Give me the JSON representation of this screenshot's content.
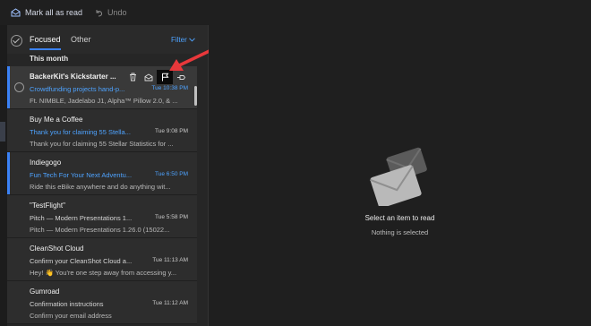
{
  "toolbar": {
    "mark_all_read": "Mark all as read",
    "undo": "Undo"
  },
  "tabs": {
    "focused": "Focused",
    "other": "Other",
    "filter": "Filter"
  },
  "section_header": "This month",
  "messages": [
    {
      "sender": "BackerKit's Kickstarter ...",
      "subject": "Crowdfunding projects hand-p...",
      "time": "Tue 10:38 PM",
      "preview": "Ft. NIMBLE, Jadelabo J1, Alpha™ Pillow 2.0, & ..."
    },
    {
      "sender": "Buy Me a Coffee",
      "subject": "Thank you for claiming 55 Stella...",
      "time": "Tue 9:08 PM",
      "preview": "Thank you for claiming 55 Stellar Statistics for ..."
    },
    {
      "sender": "Indiegogo",
      "subject": "Fun Tech For Your Next Adventu...",
      "time": "Tue 6:50 PM",
      "preview": "Ride this eBike anywhere and do anything wit..."
    },
    {
      "sender": "\"TestFlight\"",
      "subject": "Pitch — Modern Presentations 1...",
      "time": "Tue 5:58 PM",
      "preview": "Pitch — Modern Presentations 1.26.0 (15022..."
    },
    {
      "sender": "CleanShot Cloud",
      "subject": "Confirm your CleanShot Cloud a...",
      "time": "Tue 11:13 AM",
      "preview": "Hey! 👋 You're one step away from accessing y..."
    },
    {
      "sender": "Gumroad",
      "subject": "Confirmation instructions",
      "time": "Tue 11:12 AM",
      "preview": "Confirm your email address"
    }
  ],
  "reading_pane": {
    "title": "Select an item to read",
    "subtitle": "Nothing is selected"
  },
  "colors": {
    "accent": "#3b82f6",
    "link": "#4ea3ff",
    "annotation_arrow": "#e8383b"
  },
  "icons": [
    "envelope-open-icon",
    "undo-icon",
    "check-circle-icon",
    "trash-icon",
    "mark-read-icon",
    "flag-icon",
    "pin-icon"
  ]
}
